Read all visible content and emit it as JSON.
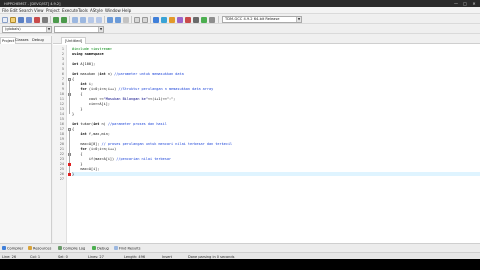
{
  "window": {
    "title": "HIPPCHEMST - [DEVC/IST] 4.9.2]",
    "min_glyph": "—",
    "max_glyph": "□",
    "close_glyph": "✕"
  },
  "menu": [
    "File",
    "Edit",
    "Search",
    "View",
    "Project",
    "Execute",
    "Tools",
    "AStyle",
    "Window",
    "Help"
  ],
  "toolbar": {
    "compiler_select": "TDM-GCC 4.9.2 64-bit Release",
    "globals_select": "(globals)"
  },
  "left_panel": {
    "tabs": [
      "Project",
      "Classes",
      "Debug"
    ]
  },
  "editor": {
    "tab_label": "[Untitled]",
    "lines": [
      {
        "n": "1",
        "segs": [
          {
            "t": "#include <iostream>",
            "c": "pp"
          }
        ]
      },
      {
        "n": "2",
        "segs": [
          {
            "t": "using namespace",
            "c": "kw"
          }
        ]
      },
      {
        "n": "3",
        "segs": [
          {
            "t": "",
            "c": ""
          }
        ]
      },
      {
        "n": "4",
        "segs": [
          {
            "t": "int",
            "c": "kw"
          },
          {
            "t": " A[100];",
            "c": ""
          }
        ]
      },
      {
        "n": "5",
        "segs": [
          {
            "t": "",
            "c": ""
          }
        ]
      },
      {
        "n": "6",
        "segs": [
          {
            "t": "int",
            "c": "kw"
          },
          {
            "t": " masukan (",
            "c": ""
          },
          {
            "t": "int",
            "c": "kw"
          },
          {
            "t": " n) ",
            "c": ""
          },
          {
            "t": "//parameter untuk memasukkan data",
            "c": "cm"
          }
        ]
      },
      {
        "n": "7",
        "segs": [
          {
            "t": "{",
            "c": ""
          }
        ]
      },
      {
        "n": "8",
        "segs": [
          {
            "t": "    int",
            "c": "kw"
          },
          {
            "t": " i;",
            "c": ""
          }
        ]
      },
      {
        "n": "9",
        "segs": [
          {
            "t": "    for",
            "c": "kw"
          },
          {
            "t": " (i=0;i<n;i++) ",
            "c": ""
          },
          {
            "t": "//Struktur perulangan n memasukkan data array",
            "c": "cm"
          }
        ]
      },
      {
        "n": "10",
        "segs": [
          {
            "t": "    {",
            "c": ""
          }
        ]
      },
      {
        "n": "11",
        "segs": [
          {
            "t": "        cout <<",
            "c": ""
          },
          {
            "t": "\"Masukan Bilangan ke\"",
            "c": "st"
          },
          {
            "t": "<<(i+1)<<\":\";",
            "c": ""
          }
        ]
      },
      {
        "n": "12",
        "segs": [
          {
            "t": "        cin>>A[i];",
            "c": ""
          }
        ]
      },
      {
        "n": "13",
        "segs": [
          {
            "t": "    }",
            "c": ""
          }
        ]
      },
      {
        "n": "14",
        "segs": [
          {
            "t": "}",
            "c": ""
          }
        ]
      },
      {
        "n": "15",
        "segs": [
          {
            "t": "",
            "c": ""
          }
        ]
      },
      {
        "n": "16",
        "segs": [
          {
            "t": "int",
            "c": "kw"
          },
          {
            "t": " tukar(",
            "c": ""
          },
          {
            "t": "int",
            "c": "kw"
          },
          {
            "t": " n) ",
            "c": ""
          },
          {
            "t": "//parameter proses dan hasil",
            "c": "cm"
          }
        ]
      },
      {
        "n": "17",
        "segs": [
          {
            "t": "{",
            "c": ""
          }
        ]
      },
      {
        "n": "18",
        "segs": [
          {
            "t": "    int",
            "c": "kw"
          },
          {
            "t": " f,max,min;",
            "c": ""
          }
        ]
      },
      {
        "n": "19",
        "segs": [
          {
            "t": "",
            "c": ""
          }
        ]
      },
      {
        "n": "20",
        "segs": [
          {
            "t": "    max=A[0]; ",
            "c": ""
          },
          {
            "t": "// proses perulangan untuk mencari nilai terbesar dan terkecil",
            "c": "cm"
          }
        ]
      },
      {
        "n": "21",
        "segs": [
          {
            "t": "    for",
            "c": "kw"
          },
          {
            "t": " (i=0;i<n;i++)",
            "c": ""
          }
        ]
      },
      {
        "n": "22",
        "segs": [
          {
            "t": "    {",
            "c": ""
          }
        ]
      },
      {
        "n": "23",
        "segs": [
          {
            "t": "        if(max<A[i]) ",
            "c": ""
          },
          {
            "t": "//pencarian nilai terbesar",
            "c": "cm"
          }
        ]
      },
      {
        "n": "24",
        "segs": [
          {
            "t": "    }",
            "c": ""
          }
        ]
      },
      {
        "n": "25",
        "segs": [
          {
            "t": "    max=A[i];",
            "c": ""
          }
        ]
      },
      {
        "n": "26",
        "segs": [
          {
            "t": "}",
            "c": ""
          }
        ]
      },
      {
        "n": "27",
        "segs": [
          {
            "t": "",
            "c": ""
          }
        ]
      }
    ]
  },
  "bottom_tabs": [
    "Compiler",
    "Resources",
    "Compile Log",
    "Debug",
    "Find Results"
  ],
  "status": {
    "line_label": "Line:",
    "line_value": "26",
    "col_label": "Col:",
    "col_value": "1",
    "sel_label": "Sel:",
    "sel_value": "0",
    "lines_label": "Lines:",
    "lines_value": "27",
    "length_label": "Length:",
    "length_value": "496",
    "mode": "Insert",
    "message": "Done parsing in 0 seconds"
  },
  "colors": {
    "comment": "#1c44d8",
    "preprocessor": "#00870e",
    "current_line": "#dff4ff",
    "error_marker": "#e02020"
  }
}
